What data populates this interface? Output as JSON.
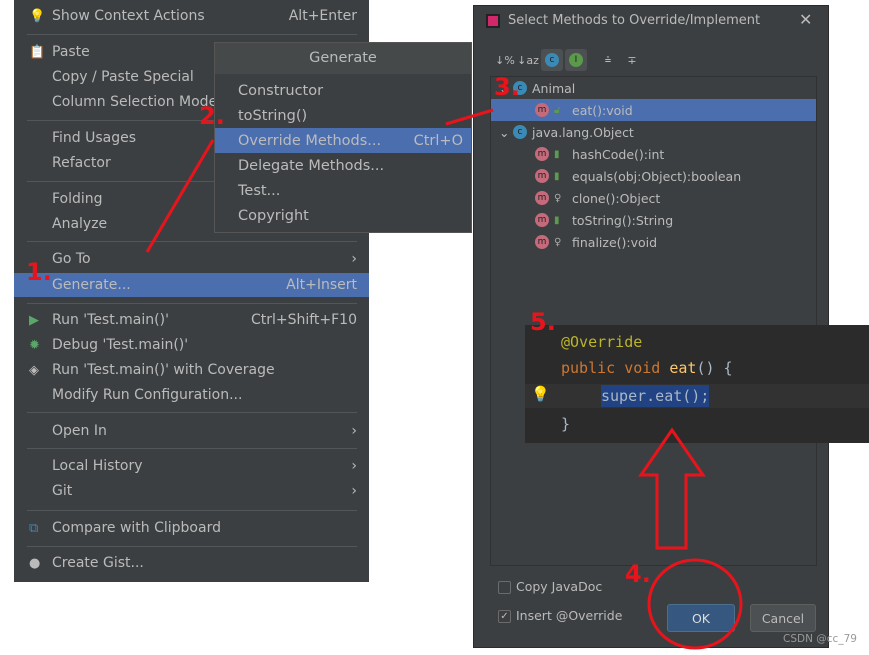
{
  "context_menu": {
    "items": [
      {
        "label": "Show Context Actions",
        "shortcut": "Alt+Enter",
        "icon": "lightbulb-icon"
      },
      {
        "label": "Paste",
        "icon": "clipboard-icon"
      },
      {
        "label": "Copy / Paste Special"
      },
      {
        "label": "Column Selection Mode"
      },
      {
        "label": "Find Usages"
      },
      {
        "label": "Refactor"
      },
      {
        "label": "Folding"
      },
      {
        "label": "Analyze"
      },
      {
        "label": "Go To",
        "submenu": true
      },
      {
        "label": "Generate...",
        "shortcut": "Alt+Insert",
        "selected": true
      },
      {
        "label": "Run 'Test.main()'",
        "shortcut": "Ctrl+Shift+F10",
        "icon": "run-icon"
      },
      {
        "label": "Debug 'Test.main()'",
        "icon": "debug-icon"
      },
      {
        "label": "Run 'Test.main()' with Coverage",
        "icon": "coverage-icon"
      },
      {
        "label": "Modify Run Configuration..."
      },
      {
        "label": "Open In",
        "submenu": true
      },
      {
        "label": "Local History",
        "submenu": true
      },
      {
        "label": "Git",
        "submenu": true
      },
      {
        "label": "Compare with Clipboard",
        "icon": "compare-icon"
      },
      {
        "label": "Create Gist...",
        "icon": "github-icon"
      }
    ]
  },
  "generate_menu": {
    "title": "Generate",
    "items": [
      {
        "label": "Constructor"
      },
      {
        "label": "toString()"
      },
      {
        "label": "Override Methods...",
        "shortcut": "Ctrl+O",
        "selected": true
      },
      {
        "label": "Delegate Methods..."
      },
      {
        "label": "Test..."
      },
      {
        "label": "Copyright"
      }
    ]
  },
  "dialog": {
    "title": "Select Methods to Override/Implement",
    "tree": [
      {
        "label": "Animal",
        "type": "class",
        "level": 0
      },
      {
        "label": "eat():void",
        "type": "method",
        "level": 1,
        "selected": true,
        "access": "public"
      },
      {
        "label": "java.lang.Object",
        "type": "class",
        "level": 0
      },
      {
        "label": "hashCode():int",
        "type": "method",
        "level": 1,
        "access": "public"
      },
      {
        "label": "equals(obj:Object):boolean",
        "type": "method",
        "level": 1,
        "access": "public"
      },
      {
        "label": "clone():Object",
        "type": "method",
        "level": 1,
        "access": "protected"
      },
      {
        "label": "toString():String",
        "type": "method",
        "level": 1,
        "access": "public"
      },
      {
        "label": "finalize():void",
        "type": "method",
        "level": 1,
        "access": "protected"
      }
    ],
    "copy_javadoc": {
      "label": "Copy JavaDoc",
      "checked": false
    },
    "insert_override": {
      "label": "Insert @Override",
      "checked": true
    },
    "ok": "OK",
    "cancel": "Cancel"
  },
  "code": {
    "l1": "@Override",
    "l2a": "public void ",
    "l2b": "eat",
    "l2c": "() {",
    "l3": "super.eat();",
    "l4": "}"
  },
  "annotations": {
    "n1": "1.",
    "n2": "2.",
    "n3": "3.",
    "n4": "4.",
    "n5": "5.",
    "color": "#e8141c"
  },
  "watermark": "CSDN @cc_79"
}
